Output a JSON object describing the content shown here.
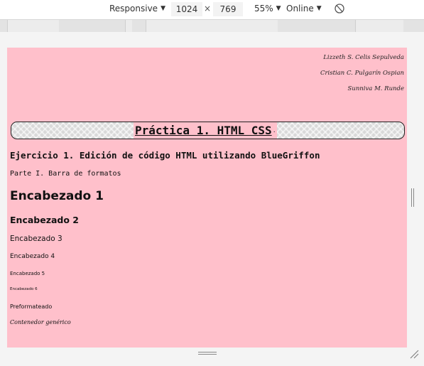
{
  "toolbar": {
    "device": "Responsive",
    "width": "1024",
    "times": "×",
    "height": "769",
    "zoom": "55%",
    "throttle": "Online"
  },
  "page": {
    "authors": [
      "Lizzeth S. Celis Sepulveda",
      "Cristian C. Pulgarín Ospian",
      "Sunniva M. Runde"
    ],
    "banner_title": "Práctica 1. HTML CSS",
    "banner_dot": ".",
    "exercise": "Ejercicio 1. Edición de código HTML utilizando BlueGriffon",
    "part": "Parte I. Barra de formatos",
    "h1": "Encabezado 1",
    "h2": "Encabezado 2",
    "h3": "Encabezado 3",
    "h4": "Encabezado 4",
    "h5": "Encabezado 5",
    "h6": "Encabezado 6",
    "pre": "Preformateado",
    "div": "Contenedor genérico"
  },
  "colors": {
    "page_bg": "#ffc0cb"
  },
  "icons": [
    "dropdown-arrow-icon",
    "rotate-icon",
    "resize-handle-icon"
  ]
}
